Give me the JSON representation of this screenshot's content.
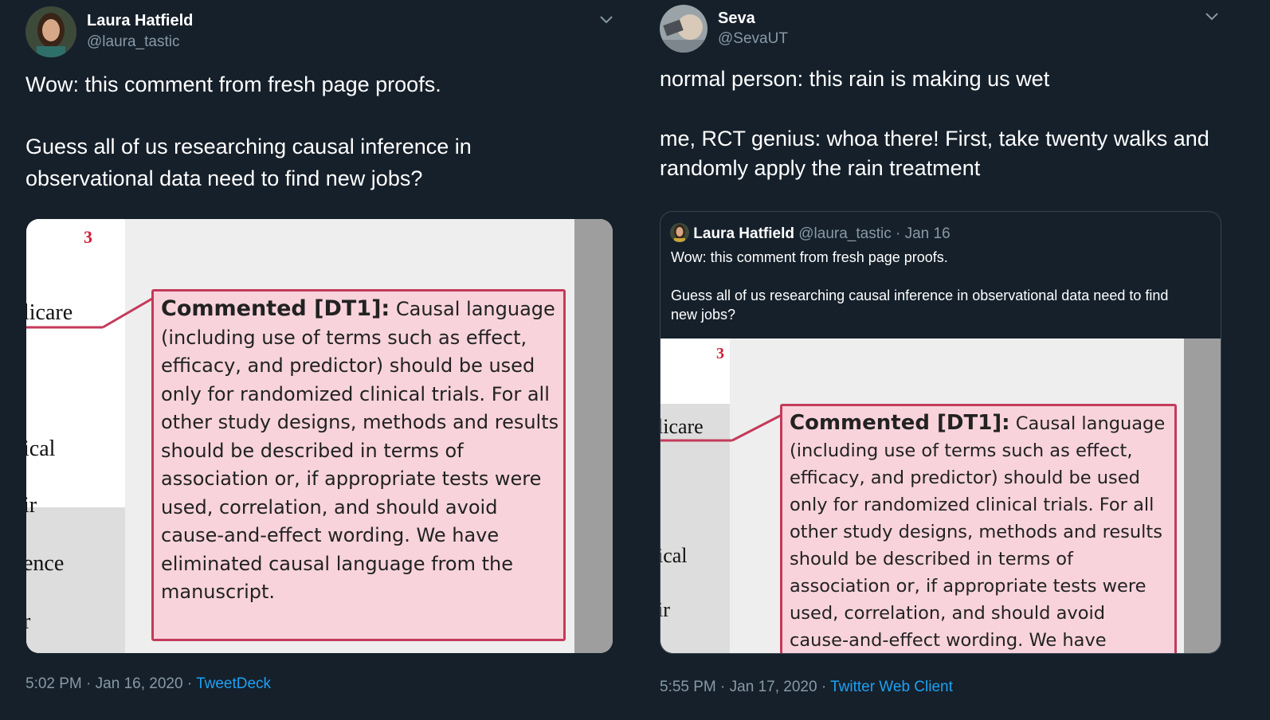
{
  "tweets": [
    {
      "author_name": "Laura Hatfield",
      "author_handle": "@laura_tastic",
      "text_line1": "Wow: this comment from fresh page proofs.",
      "text_line2": "Guess all of us researching causal inference in",
      "text_line3": "observational data need to find new jobs?",
      "time": "5:02 PM",
      "date": "Jan 16, 2020",
      "source": "TweetDeck"
    },
    {
      "author_name": "Seva",
      "author_handle": "@SevaUT",
      "text_line1": "normal person: this rain is making us wet",
      "text_line2": "me, RCT genius: whoa there! First, take twenty walks and",
      "text_line3": "randomly apply the rain treatment",
      "time": "5:55 PM",
      "date": "Jan 17, 2020",
      "source": "Twitter Web Client",
      "quoted": {
        "author_name": "Laura Hatfield",
        "author_handle": "@laura_tastic",
        "date": "Jan 16",
        "text_line1": "Wow: this comment from fresh page proofs.",
        "text_line2": "Guess all of us researching causal inference in observational data need to find",
        "text_line3": "new jobs?"
      }
    }
  ],
  "separator": "·",
  "doc": {
    "page_number": "3",
    "fragments_left": [
      "licare",
      "ical",
      "ir",
      "ence",
      "r"
    ],
    "fragments_right": [
      "licare",
      "ical",
      "ir"
    ],
    "comment_heading": "Commented [DT1]:",
    "comment_lines": [
      "Causal language",
      "(including use of terms such as effect,",
      "efficacy, and predictor) should be used",
      "only for randomized clinical trials. For all",
      "other study designs, methods and results",
      "should be described in terms of",
      "association or, if appropriate tests were",
      "used, correlation, and should avoid",
      "cause-and-effect wording. We have",
      "eliminated causal language from the",
      "manuscript."
    ]
  },
  "icons": {
    "menu": "chevron-down-icon",
    "avatar1": "avatar-photo-icon",
    "avatar2": "avatar-photo-icon"
  },
  "colors": {
    "background": "#15202b",
    "secondary_text": "#8899a6",
    "link": "#1da1f2",
    "comment_fill": "#f8d3dc",
    "comment_border": "#c43a5a"
  }
}
